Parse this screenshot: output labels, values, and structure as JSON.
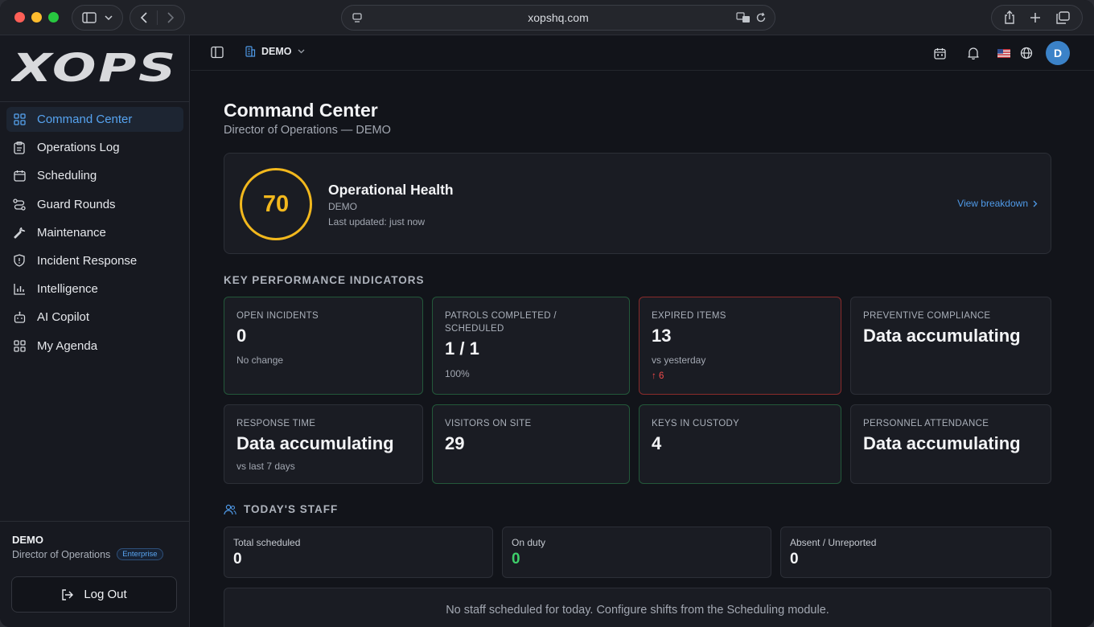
{
  "browser": {
    "url": "xopshq.com"
  },
  "brand": {
    "logo_text": "XOPS",
    "accent": "#56a3f0"
  },
  "sidebar": {
    "items": [
      {
        "label": "Command Center",
        "icon": "grid-icon",
        "active": true
      },
      {
        "label": "Operations Log",
        "icon": "clipboard-icon"
      },
      {
        "label": "Scheduling",
        "icon": "calendar-icon"
      },
      {
        "label": "Guard Rounds",
        "icon": "route-icon"
      },
      {
        "label": "Maintenance",
        "icon": "wrench-icon"
      },
      {
        "label": "Incident Response",
        "icon": "shield-icon"
      },
      {
        "label": "Intelligence",
        "icon": "bar-chart-icon"
      },
      {
        "label": "AI Copilot",
        "icon": "bot-icon"
      },
      {
        "label": "My Agenda",
        "icon": "grid-icon"
      }
    ],
    "user": {
      "name": "DEMO",
      "role": "Director of Operations",
      "plan": "Enterprise"
    },
    "logout_label": "Log Out"
  },
  "topbar": {
    "org": "DEMO",
    "avatar_initial": "D"
  },
  "page": {
    "title": "Command Center",
    "subtitle": "Director of Operations — DEMO"
  },
  "health": {
    "score": "70",
    "title": "Operational Health",
    "org": "DEMO",
    "updated": "Last updated: just now",
    "breakdown_label": "View breakdown",
    "ring_color": "#f2b81d"
  },
  "kpi": {
    "heading": "KEY PERFORMANCE INDICATORS",
    "cards": [
      {
        "label": "OPEN INCIDENTS",
        "value": "0",
        "sub": "No change",
        "status": "green"
      },
      {
        "label": "PATROLS COMPLETED / SCHEDULED",
        "value": "1 / 1",
        "sub": "100%",
        "status": "green"
      },
      {
        "label": "EXPIRED ITEMS",
        "value": "13",
        "sub": "vs yesterday",
        "trend": "↑ 6",
        "status": "red"
      },
      {
        "label": "PREVENTIVE COMPLIANCE",
        "value": "Data accumulating",
        "status": "neutral"
      },
      {
        "label": "RESPONSE TIME",
        "value": "Data accumulating",
        "sub": "vs last 7 days",
        "status": "neutral"
      },
      {
        "label": "VISITORS ON SITE",
        "value": "29",
        "status": "green"
      },
      {
        "label": "KEYS IN CUSTODY",
        "value": "4",
        "status": "green"
      },
      {
        "label": "PERSONNEL ATTENDANCE",
        "value": "Data accumulating",
        "status": "neutral"
      }
    ]
  },
  "staff": {
    "heading": "TODAY'S STAFF",
    "cards": [
      {
        "label": "Total scheduled",
        "value": "0"
      },
      {
        "label": "On duty",
        "value": "0"
      },
      {
        "label": "Absent / Unreported",
        "value": "0"
      }
    ],
    "empty_note": "No staff scheduled for today. Configure shifts from the Scheduling module."
  }
}
